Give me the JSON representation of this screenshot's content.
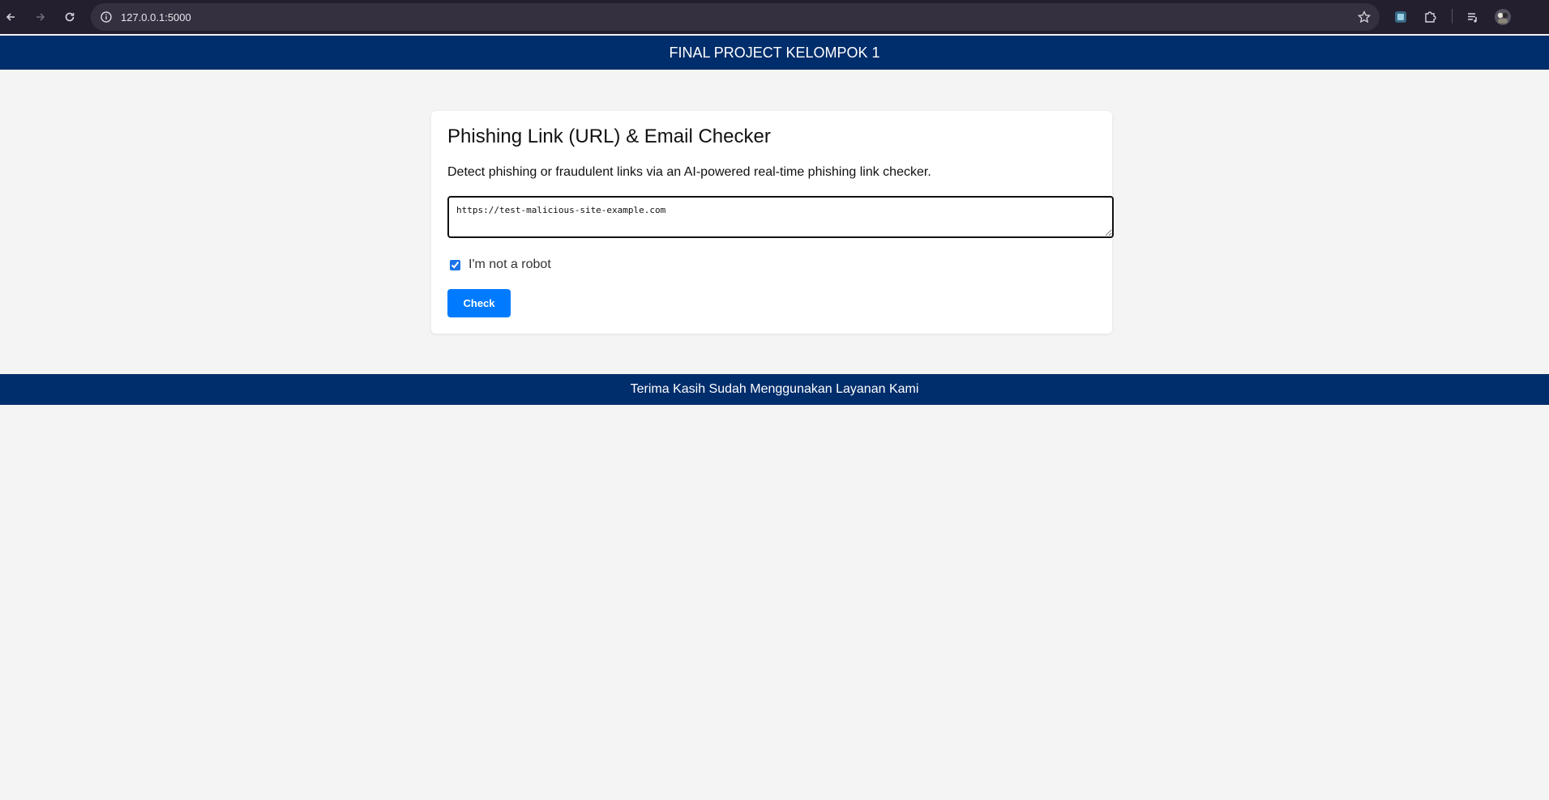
{
  "browser": {
    "url": "127.0.0.1:5000",
    "icons": [
      "back-icon",
      "forward-icon",
      "reload-icon",
      "info-icon",
      "star-icon",
      "extension-icon",
      "puzzle-icon",
      "media-queue-icon",
      "profile-avatar-icon"
    ]
  },
  "header": {
    "title": "FINAL PROJECT KELOMPOK 1"
  },
  "checker": {
    "title": "Phishing Link (URL) & Email Checker",
    "description": "Detect phishing or fraudulent links via an AI-powered real-time phishing link checker.",
    "input_value": "https://test-malicious-site-example.com",
    "captcha_label": "I'm not a robot",
    "captcha_checked": true,
    "submit_label": "Check"
  },
  "footer": {
    "text": "Terima Kasih Sudah Menggunakan Layanan Kami"
  },
  "colors": {
    "header_bg": "#002d6b",
    "button_bg": "#007bff",
    "page_bg": "#f4f4f4"
  }
}
